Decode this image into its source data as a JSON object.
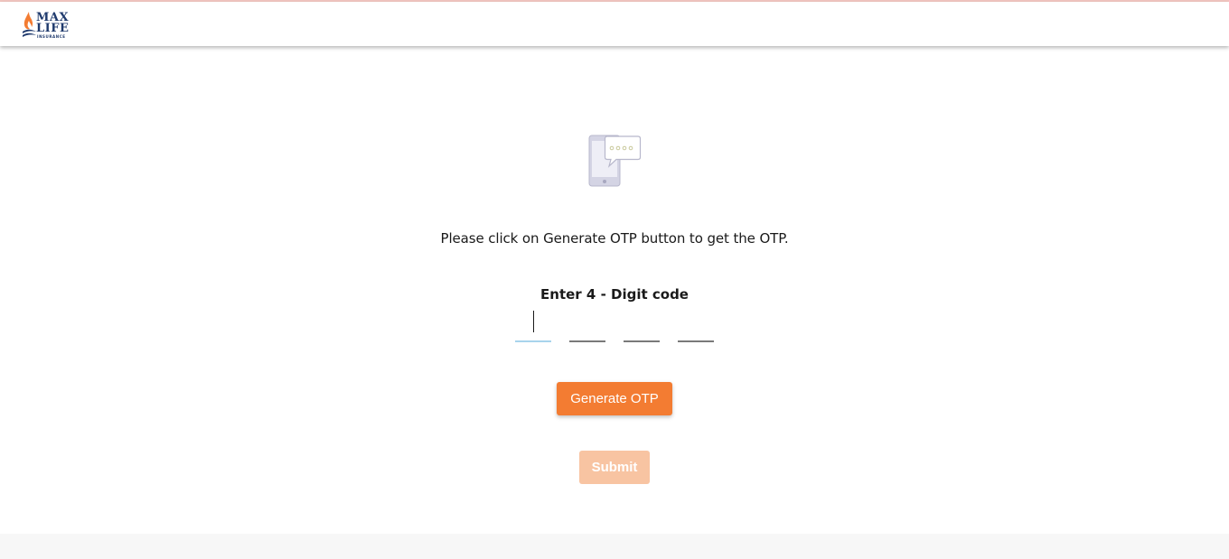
{
  "brand": {
    "logo_line1": "MAX",
    "logo_line2": "LIFE",
    "logo_line3": "INSURANCE",
    "primary_color": "#1f3a6d",
    "accent_color": "#f37c32"
  },
  "icons": {
    "header_logo": "max-life-flame-logo",
    "illustration": "phone-message-icon"
  },
  "otp": {
    "instruction": "Please click on Generate OTP button to get the OTP.",
    "code_label": "Enter 4 - Digit code",
    "digits": [
      "",
      "",
      "",
      ""
    ],
    "active_index": 0
  },
  "actions": {
    "generate_label": "Generate OTP",
    "submit_label": "Submit",
    "submit_disabled": true
  }
}
